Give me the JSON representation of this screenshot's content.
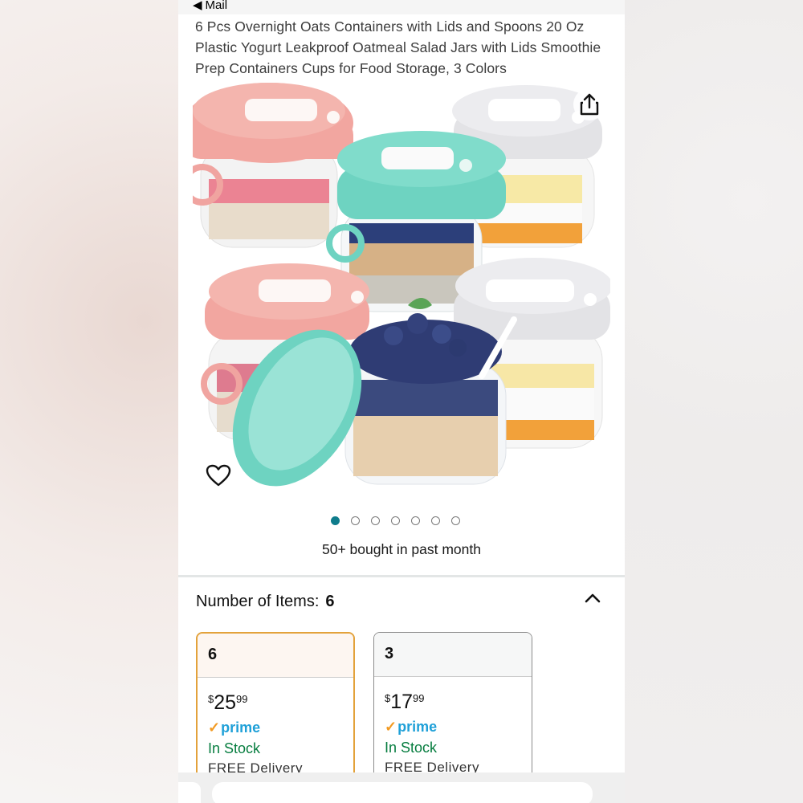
{
  "status_bar": {
    "back_label": "Mail"
  },
  "product": {
    "title": "6 Pcs Overnight Oats Containers with Lids and Spoons 20 Oz Plastic Yogurt Leakproof Oatmeal Salad Jars with Lids Smoothie Prep Containers Cups for Food Storage, 3 Colors",
    "image_icon": "jars-product-photo",
    "carousel": {
      "total": 7,
      "active": 1
    },
    "social_proof": "50+ bought in past month"
  },
  "options": {
    "label": "Number of Items:",
    "selected_value": "6",
    "cards": [
      {
        "qty": "6",
        "currency": "$",
        "whole": "25",
        "cents": "99",
        "prime": "prime",
        "stock": "In Stock",
        "delivery": "FREE Delivery"
      },
      {
        "qty": "3",
        "currency": "$",
        "whole": "17",
        "cents": "99",
        "prime": "prime",
        "stock": "In Stock",
        "delivery": "FREE Delivery"
      }
    ]
  },
  "colors": {
    "accent": "#0f7c8c",
    "selected_border": "#e3a23b",
    "in_stock": "#067d3f",
    "prime": "#1fa0d8"
  }
}
